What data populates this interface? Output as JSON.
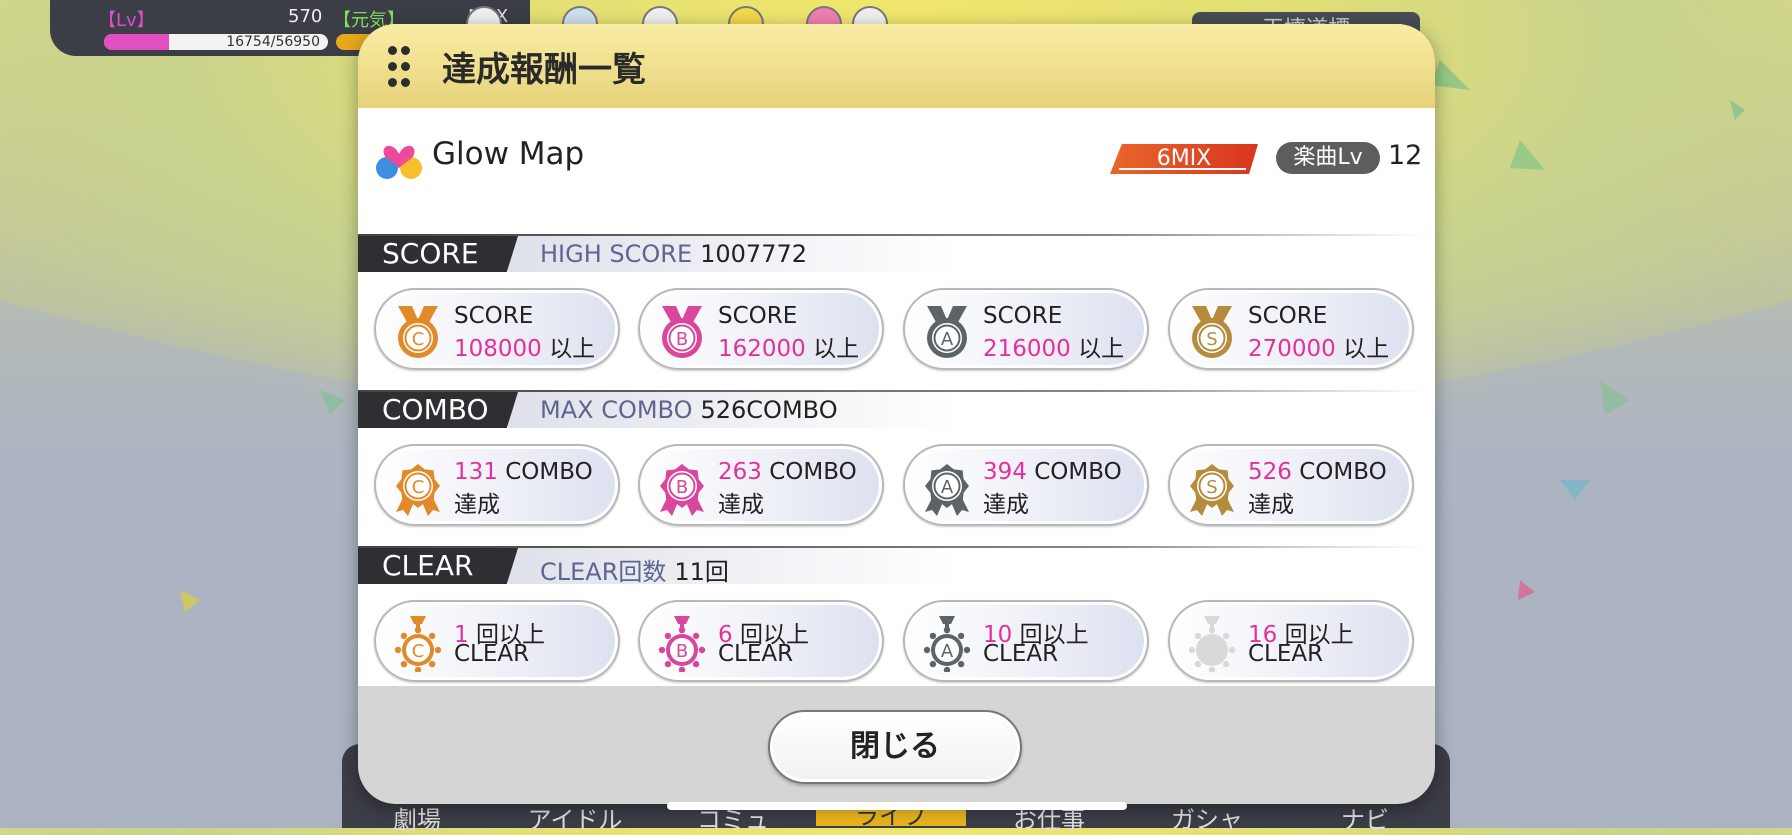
{
  "status_bar": {
    "lv_label": "【Lv】",
    "stamina_value": "570",
    "genki_label": "【元気】",
    "max_label": "MAX",
    "exp_text": "16754/56950",
    "exp_fraction": 0.29
  },
  "top_right_button": {
    "label": "干壊道標"
  },
  "bottom_nav": {
    "items": [
      "劇場",
      "アイドル",
      "コミュ",
      "ライブ",
      "お仕事",
      "ガシャ",
      "ナビ"
    ],
    "active_index": 3
  },
  "modal": {
    "title": "達成報酬一覧",
    "song": {
      "title": "Glow Map",
      "mix": "6MIX",
      "level_label": "楽曲Lv",
      "level": "12"
    },
    "score": {
      "label": "SCORE",
      "stat_label": "HIGH SCORE",
      "stat_value": "1007772",
      "rewards": [
        {
          "rank": "C",
          "line1": "SCORE",
          "value": "108000",
          "suffix": "以上"
        },
        {
          "rank": "B",
          "line1": "SCORE",
          "value": "162000",
          "suffix": "以上"
        },
        {
          "rank": "A",
          "line1": "SCORE",
          "value": "216000",
          "suffix": "以上"
        },
        {
          "rank": "S",
          "line1": "SCORE",
          "value": "270000",
          "suffix": "以上"
        }
      ]
    },
    "combo": {
      "label": "COMBO",
      "stat_label": "MAX COMBO",
      "stat_value": "526COMBO",
      "rewards": [
        {
          "rank": "C",
          "value": "131",
          "unit": "COMBO",
          "line2": "達成"
        },
        {
          "rank": "B",
          "value": "263",
          "unit": "COMBO",
          "line2": "達成"
        },
        {
          "rank": "A",
          "value": "394",
          "unit": "COMBO",
          "line2": "達成"
        },
        {
          "rank": "S",
          "value": "526",
          "unit": "COMBO",
          "line2": "達成"
        }
      ]
    },
    "clear": {
      "label": "CLEAR",
      "stat_label": "CLEAR回数",
      "stat_value": "11回",
      "rewards": [
        {
          "rank": "C",
          "value": "1",
          "unit": "回以上",
          "line2": "CLEAR"
        },
        {
          "rank": "B",
          "value": "6",
          "unit": "回以上",
          "line2": "CLEAR"
        },
        {
          "rank": "A",
          "value": "10",
          "unit": "回以上",
          "line2": "CLEAR"
        },
        {
          "rank": "S",
          "value": "16",
          "unit": "回以上",
          "line2": "CLEAR",
          "locked": true
        }
      ]
    },
    "close_label": "閉じる"
  },
  "colors": {
    "rank_C": "#e08a2a",
    "rank_B": "#d9469b",
    "rank_A": "#5d6468",
    "rank_S": "#b58c3c",
    "locked": "#d9d9d9",
    "value_pink": "#e4309e"
  }
}
